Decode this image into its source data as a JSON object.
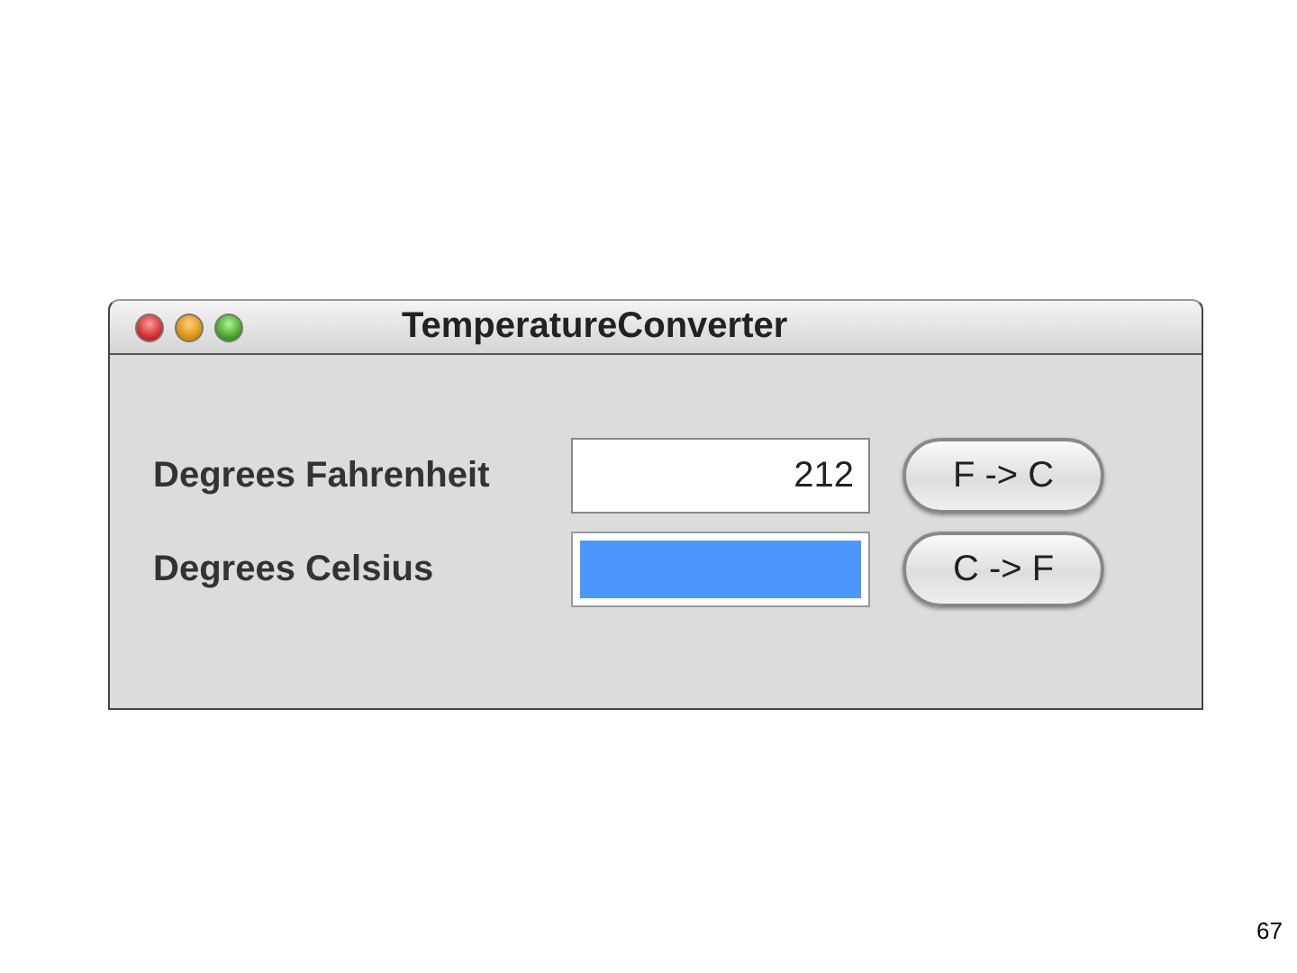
{
  "window": {
    "title": "TemperatureConverter"
  },
  "rows": [
    {
      "label": "Degrees Fahrenheit",
      "value": "212",
      "focused": false,
      "button": "F -> C"
    },
    {
      "label": "Degrees Celsius",
      "focused": true,
      "button": "C -> F"
    }
  ],
  "page_number": "67"
}
